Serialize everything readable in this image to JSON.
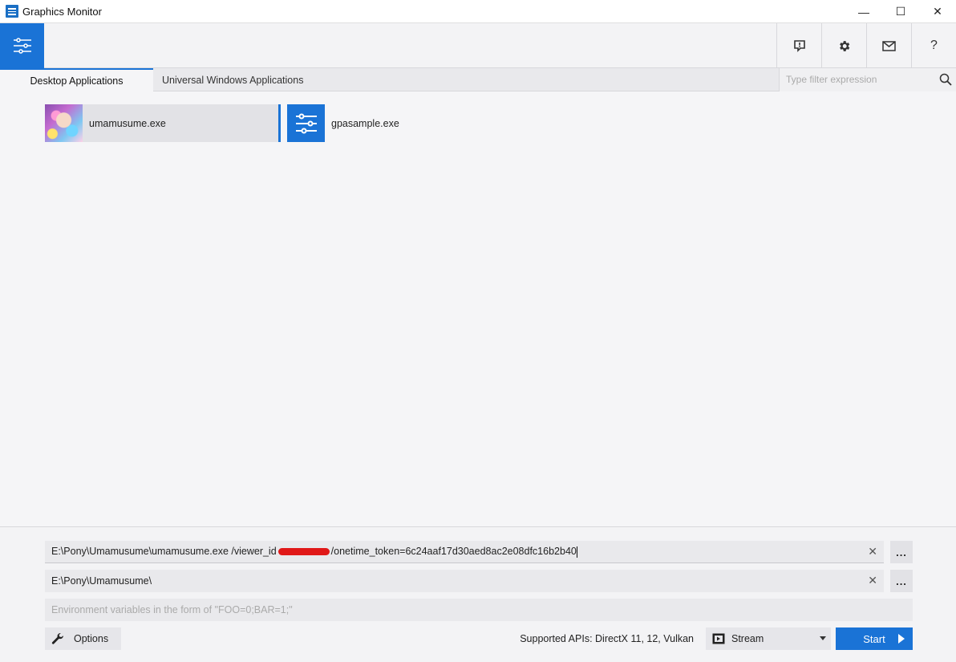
{
  "window": {
    "title": "Graphics Monitor",
    "minimize_glyph": "—",
    "maximize_glyph": "☐",
    "close_glyph": "✕"
  },
  "toolbar": {
    "menu_icon": "sliders-icon",
    "feedback_icon": "feedback-icon",
    "settings_icon": "gear-icon",
    "mail_icon": "mail-icon",
    "help_label": "?"
  },
  "tabs": [
    {
      "label": "Desktop Applications",
      "active": true
    },
    {
      "label": "Universal Windows Applications",
      "active": false
    }
  ],
  "filter": {
    "placeholder": "Type filter expression"
  },
  "apps": [
    {
      "name": "umamusume.exe",
      "selected": true
    },
    {
      "name": "gpasample.exe",
      "selected": false
    }
  ],
  "launch": {
    "command_prefix": "E:\\Pony\\Umamusume\\umamusume.exe /viewer_id",
    "command_suffix": "/onetime_token=6c24aaf17d30aed8ac2e08dfc16b2b40",
    "working_dir": "E:\\Pony\\Umamusume\\",
    "env_placeholder": "Environment variables in the form of \"FOO=0;BAR=1;\"",
    "clear_glyph": "✕",
    "browse_label": "..."
  },
  "footer": {
    "options_label": "Options",
    "supported_apis": "Supported APIs: DirectX 11, 12, Vulkan",
    "mode_selected": "Stream",
    "start_label": "Start"
  },
  "colors": {
    "accent": "#1a73d6",
    "redaction": "#e01818"
  }
}
